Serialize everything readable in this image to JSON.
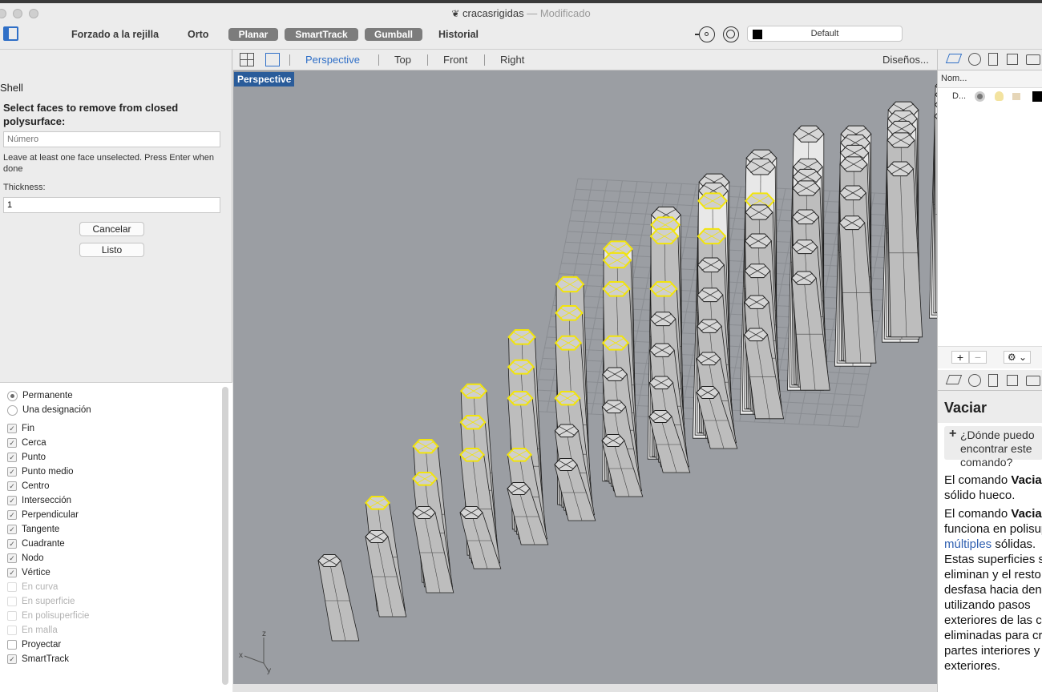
{
  "window": {
    "title": "cracasrigidas",
    "status": "— Modificado"
  },
  "toolbar": {
    "grid_snap": "Forzado a la rejilla",
    "ortho": "Orto",
    "planar": "Planar",
    "smarttrack": "SmartTrack",
    "gumball": "Gumball",
    "history": "Historial",
    "layer_name": "Default"
  },
  "command": {
    "name": "Shell",
    "prompt": "Select faces to remove from closed polysurface:",
    "number_placeholder": "Número",
    "hint": "Leave at least one face unselected. Press Enter when done",
    "thickness_label": "Thickness:",
    "thickness_value": "1",
    "cancel": "Cancelar",
    "done": "Listo"
  },
  "osnap": {
    "modes": [
      {
        "label": "Permanente",
        "selected": true
      },
      {
        "label": "Una designación",
        "selected": false
      }
    ],
    "items": [
      {
        "label": "Fin",
        "checked": true,
        "enabled": true
      },
      {
        "label": "Cerca",
        "checked": true,
        "enabled": true
      },
      {
        "label": "Punto",
        "checked": true,
        "enabled": true
      },
      {
        "label": "Punto medio",
        "checked": true,
        "enabled": true
      },
      {
        "label": "Centro",
        "checked": true,
        "enabled": true
      },
      {
        "label": "Intersección",
        "checked": true,
        "enabled": true
      },
      {
        "label": "Perpendicular",
        "checked": true,
        "enabled": true
      },
      {
        "label": "Tangente",
        "checked": true,
        "enabled": true
      },
      {
        "label": "Cuadrante",
        "checked": true,
        "enabled": true
      },
      {
        "label": "Nodo",
        "checked": true,
        "enabled": true
      },
      {
        "label": "Vértice",
        "checked": true,
        "enabled": true
      },
      {
        "label": "En curva",
        "checked": false,
        "enabled": false
      },
      {
        "label": "En superficie",
        "checked": false,
        "enabled": false
      },
      {
        "label": "En polisuperficie",
        "checked": false,
        "enabled": false
      },
      {
        "label": "En malla",
        "checked": false,
        "enabled": false
      },
      {
        "label": "Proyectar",
        "checked": false,
        "enabled": true
      },
      {
        "label": "SmartTrack",
        "checked": true,
        "enabled": true
      }
    ]
  },
  "viewports": {
    "tabs": [
      "Perspective",
      "Top",
      "Front",
      "Right"
    ],
    "active": "Perspective",
    "layouts": "Diseños...",
    "active_label": "Perspective",
    "axes": {
      "x": "x",
      "y": "y",
      "z": "z"
    }
  },
  "layers": {
    "header": "Nom...",
    "row_name": "D...",
    "add": "+",
    "remove": "−"
  },
  "help": {
    "title": "Vaciar",
    "question": "¿Dónde puedo encontrar este comando?",
    "para1": [
      "El comando Vaciar",
      "sólido hueco."
    ],
    "para2": [
      "El comando Vaciar",
      "funciona en polisuperficies",
      "múltiples sólidas.",
      "Estas superficies se",
      "eliminan y el resto se",
      "desfasa hacia dentro",
      "utilizando pasos",
      "exteriores de las caras",
      "eliminadas para crear",
      "partes interiores y",
      "exteriores."
    ],
    "bold_word": "Va"
  },
  "colors": {
    "accent": "#2f6fc7",
    "selection": "#f2e40c",
    "viewport": "#9b9ea3",
    "pill": "#7c7c7c"
  }
}
